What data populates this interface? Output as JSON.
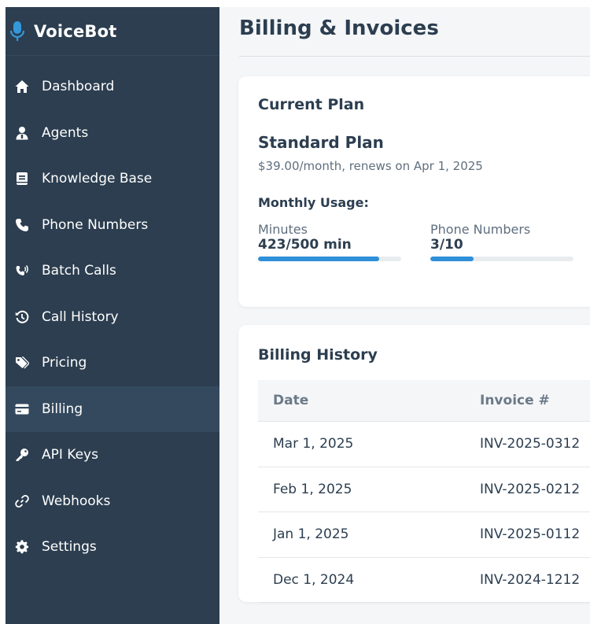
{
  "brand": {
    "name": "VoiceBot",
    "icon": "microphone-icon",
    "accent": "#3498db"
  },
  "sidebar": {
    "items": [
      {
        "label": "Dashboard",
        "icon": "home-icon",
        "active": false
      },
      {
        "label": "Agents",
        "icon": "user-agent-icon",
        "active": false
      },
      {
        "label": "Knowledge Base",
        "icon": "book-icon",
        "active": false
      },
      {
        "label": "Phone Numbers",
        "icon": "phone-icon",
        "active": false
      },
      {
        "label": "Batch Calls",
        "icon": "phone-volume-icon",
        "active": false
      },
      {
        "label": "Call History",
        "icon": "history-icon",
        "active": false
      },
      {
        "label": "Pricing",
        "icon": "tags-icon",
        "active": false
      },
      {
        "label": "Billing",
        "icon": "credit-card-icon",
        "active": true
      },
      {
        "label": "API Keys",
        "icon": "key-icon",
        "active": false
      },
      {
        "label": "Webhooks",
        "icon": "link-icon",
        "active": false
      },
      {
        "label": "Settings",
        "icon": "gear-icon",
        "active": false
      }
    ]
  },
  "page": {
    "title": "Billing & Invoices"
  },
  "plan": {
    "heading": "Current Plan",
    "name": "Standard Plan",
    "price": "$39.00/month, renews on Apr 1, 2025",
    "usage_heading": "Monthly Usage:",
    "usage": [
      {
        "label": "Minutes",
        "value": "423/500 min",
        "fraction": 0.846
      },
      {
        "label": "Phone Numbers",
        "value": "3/10",
        "fraction": 0.3
      }
    ]
  },
  "history": {
    "heading": "Billing History",
    "columns": [
      "Date",
      "Invoice #"
    ],
    "rows": [
      [
        "Mar 1, 2025",
        "INV-2025-0312"
      ],
      [
        "Feb 1, 2025",
        "INV-2025-0212"
      ],
      [
        "Jan 1, 2025",
        "INV-2025-0112"
      ],
      [
        "Dec 1, 2024",
        "INV-2024-1212"
      ]
    ]
  },
  "colors": {
    "sidebar": "#2c3e50",
    "sidebar_active": "#34495e",
    "progress": "#2f8fd8"
  }
}
